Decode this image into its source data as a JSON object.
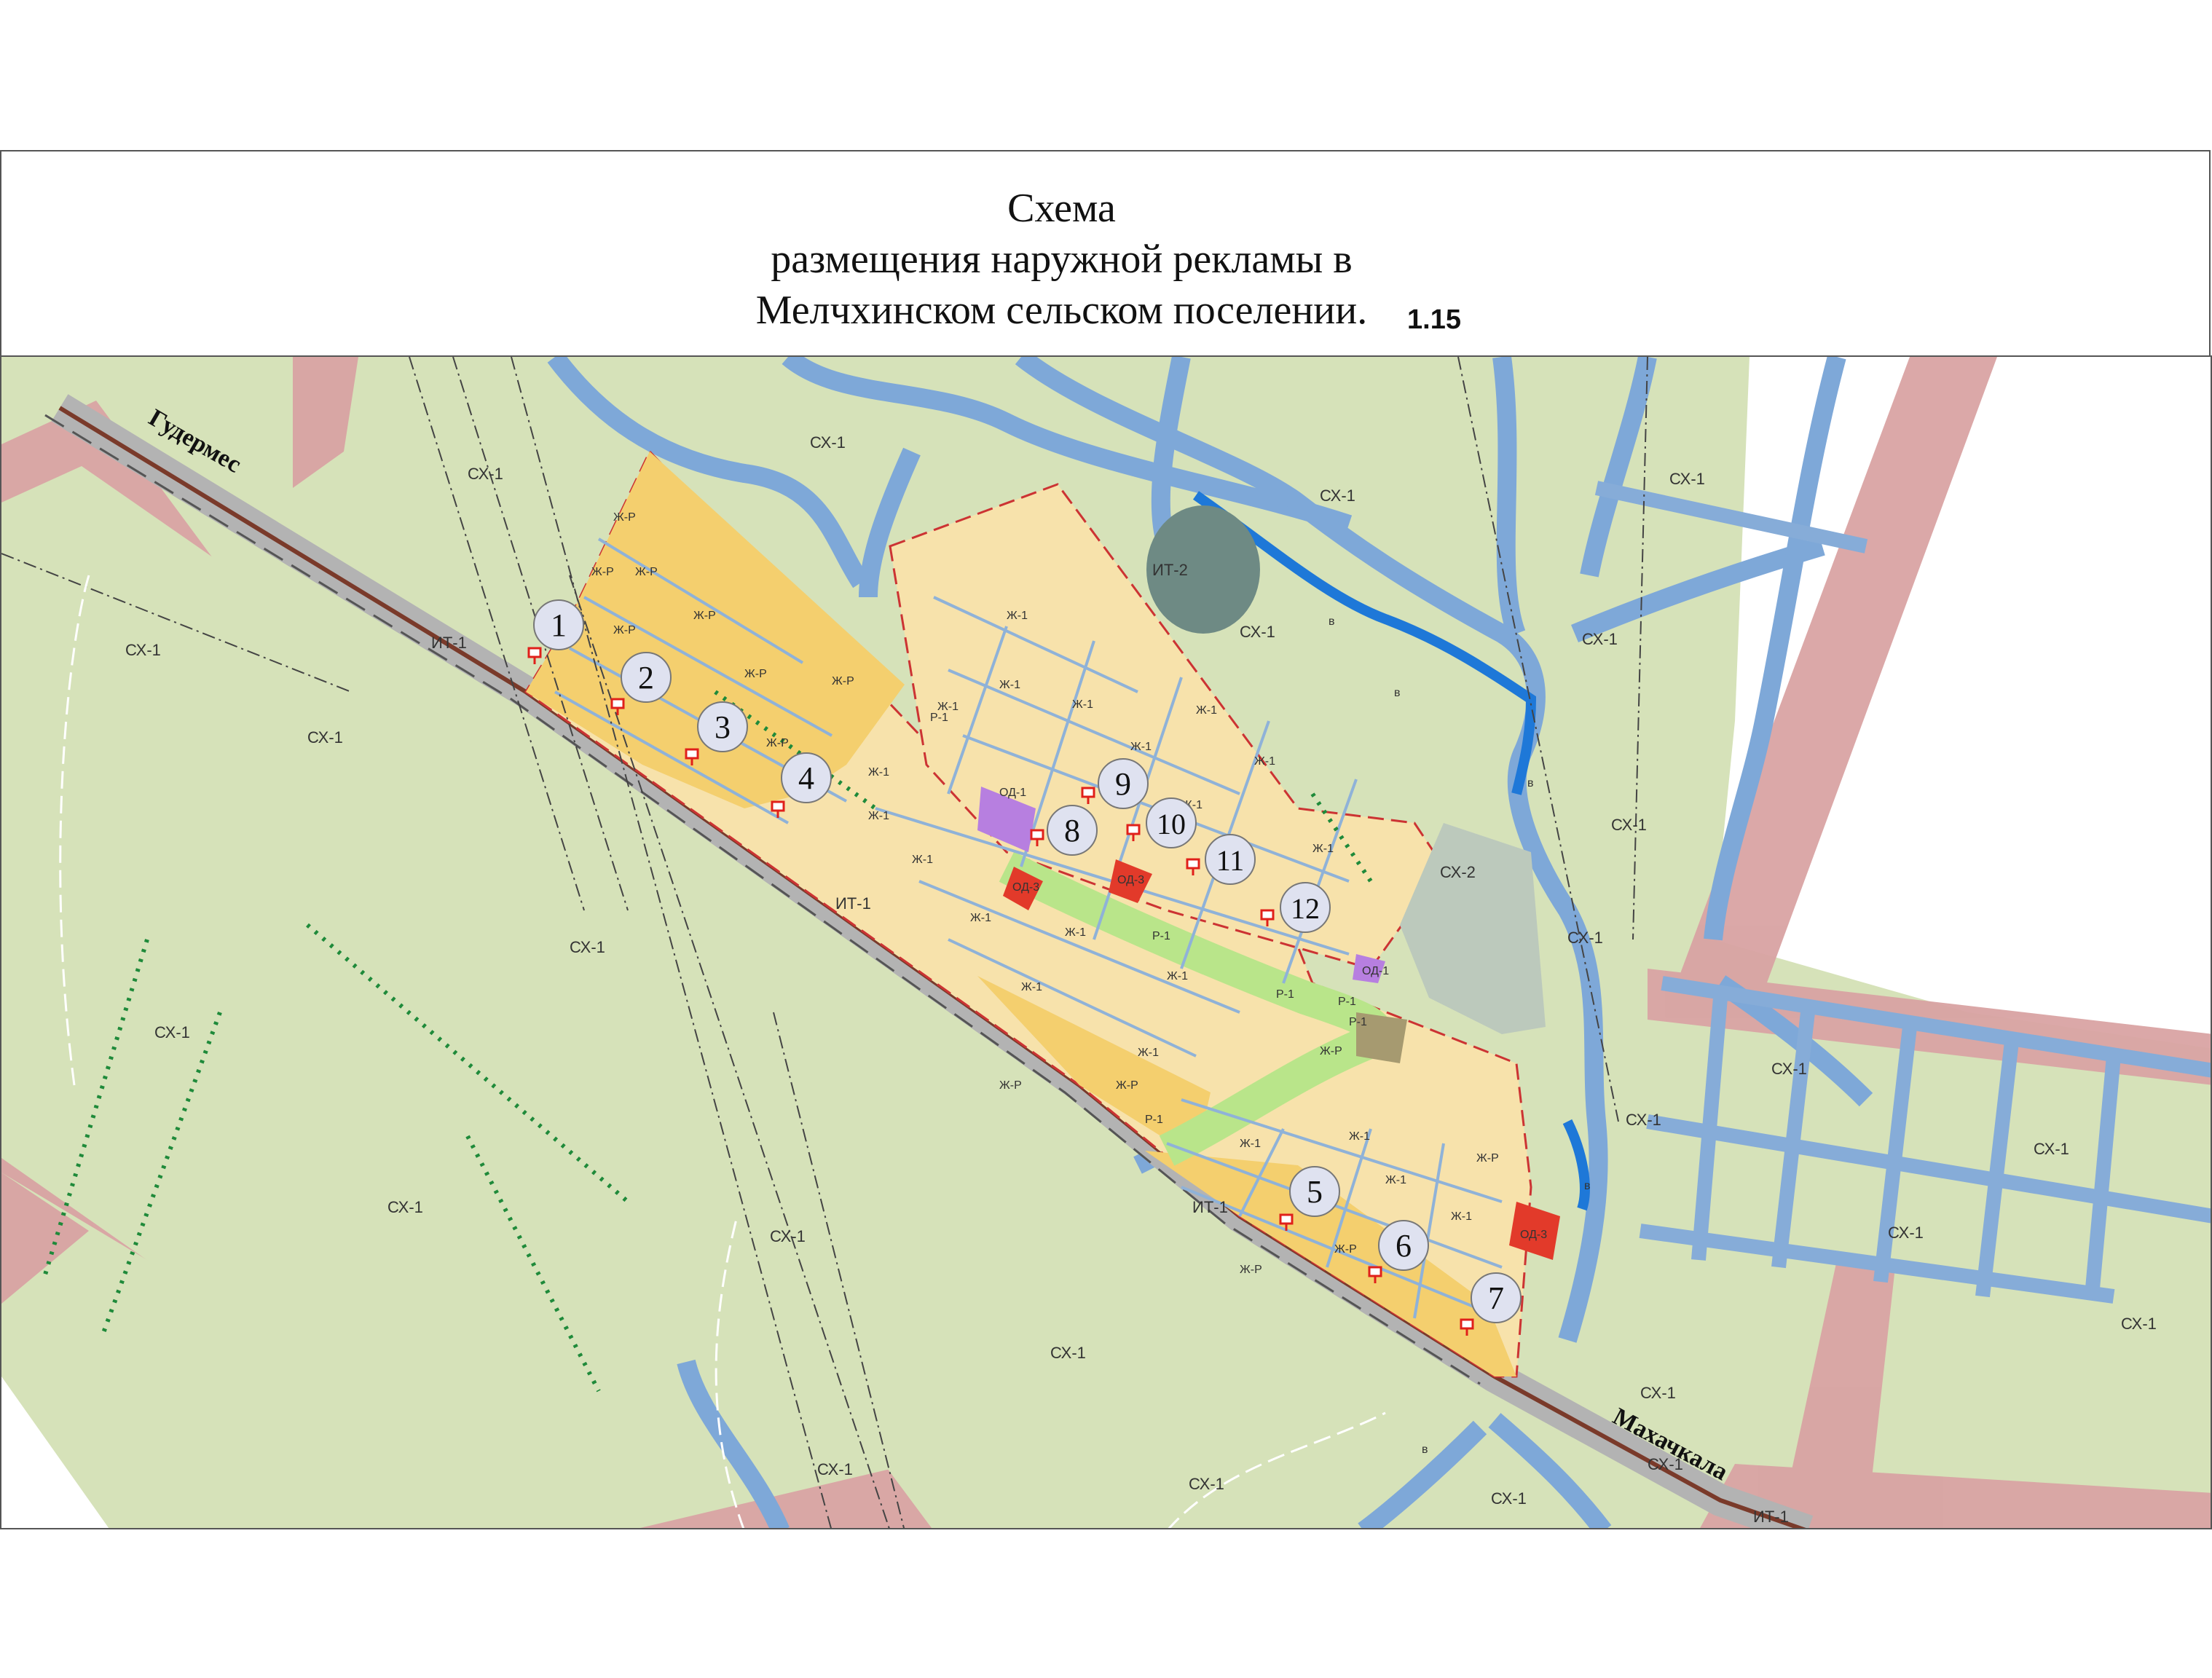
{
  "title": {
    "line1": "Схема",
    "line2": "размещения наружной рекламы в",
    "line3": "Мелчхинском сельском поселении.",
    "sheet_number": "1.15"
  },
  "roads": {
    "west": "Гудермес",
    "east": "Махачкала"
  },
  "zones": {
    "agri": "СХ-1",
    "agri2": "СХ-2",
    "infra1": "ИТ-1",
    "infra2": "ИТ-2",
    "res": "Ж-1",
    "res_r": "Ж-Р",
    "pub1": "ОД-1",
    "pub3": "ОД-3",
    "rec": "Р-1",
    "water": "в"
  },
  "ad_sites": [
    "1",
    "2",
    "3",
    "4",
    "5",
    "6",
    "7",
    "8",
    "9",
    "10",
    "11",
    "12"
  ],
  "colors": {
    "agri": "#d3e0b4",
    "buffer": "#d9a0a0",
    "residential": "#f7e3ad",
    "residential_r": "#f5cf6c",
    "water": "#6f9fd4",
    "road": "#a8a8a8",
    "ad_marker": "#e0201a"
  }
}
